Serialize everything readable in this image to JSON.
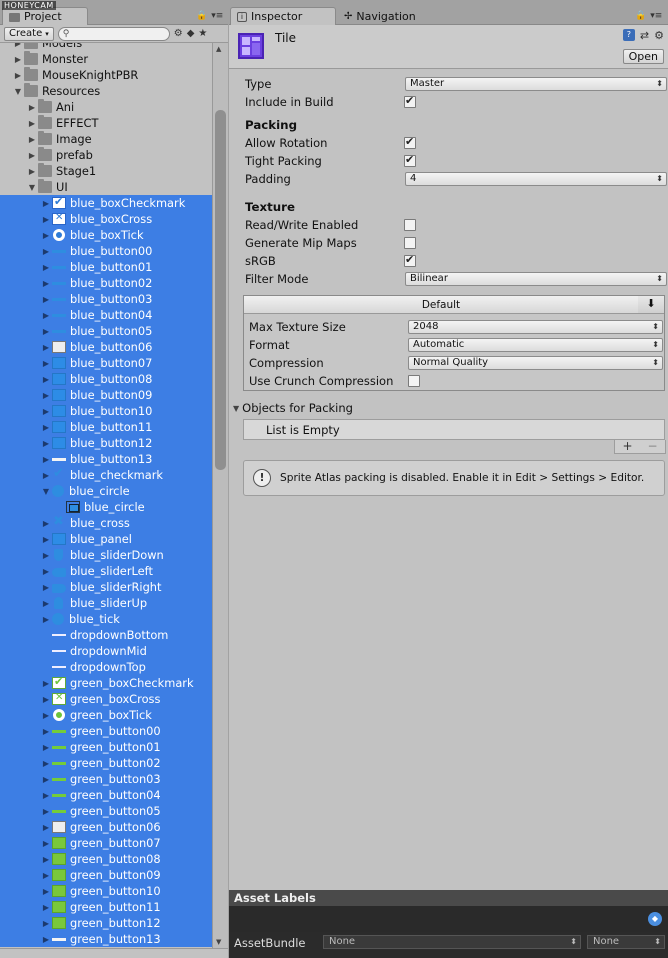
{
  "watermark": "HONEYCAM",
  "project_panel": {
    "tab_label": "Project",
    "create_label": "Create",
    "search_placeholder": "",
    "tree": [
      {
        "label": "Models",
        "type": "folder",
        "depth": 1,
        "fold": "right",
        "selected": false
      },
      {
        "label": "Monster",
        "type": "folder",
        "depth": 1,
        "fold": "right",
        "selected": false
      },
      {
        "label": "MouseKnightPBR",
        "type": "folder",
        "depth": 1,
        "fold": "right",
        "selected": false
      },
      {
        "label": "Resources",
        "type": "folder",
        "depth": 1,
        "fold": "down",
        "selected": false
      },
      {
        "label": "Ani",
        "type": "folder",
        "depth": 2,
        "fold": "right",
        "selected": false
      },
      {
        "label": "EFFECT",
        "type": "folder",
        "depth": 2,
        "fold": "right",
        "selected": false
      },
      {
        "label": "Image",
        "type": "folder",
        "depth": 2,
        "fold": "right",
        "selected": false
      },
      {
        "label": "prefab",
        "type": "folder",
        "depth": 2,
        "fold": "right",
        "selected": false
      },
      {
        "label": "Stage1",
        "type": "folder",
        "depth": 2,
        "fold": "right",
        "selected": false
      },
      {
        "label": "UI",
        "type": "folder",
        "depth": 2,
        "fold": "down",
        "selected": false
      },
      {
        "label": "blue_boxCheckmark",
        "type": "i-check",
        "depth": 3,
        "fold": "right",
        "selected": true
      },
      {
        "label": "blue_boxCross",
        "type": "i-cross",
        "depth": 3,
        "fold": "right",
        "selected": true
      },
      {
        "label": "blue_boxTick",
        "type": "i-tick",
        "depth": 3,
        "fold": "right",
        "selected": true
      },
      {
        "label": "blue_button00",
        "type": "i-bar",
        "depth": 3,
        "fold": "right",
        "selected": true
      },
      {
        "label": "blue_button01",
        "type": "i-bar",
        "depth": 3,
        "fold": "right",
        "selected": true
      },
      {
        "label": "blue_button02",
        "type": "i-bar",
        "depth": 3,
        "fold": "right",
        "selected": true
      },
      {
        "label": "blue_button03",
        "type": "i-bar",
        "depth": 3,
        "fold": "right",
        "selected": true
      },
      {
        "label": "blue_button04",
        "type": "i-bar",
        "depth": 3,
        "fold": "right",
        "selected": true
      },
      {
        "label": "blue_button05",
        "type": "i-bar",
        "depth": 3,
        "fold": "right",
        "selected": true
      },
      {
        "label": "blue_button06",
        "type": "i-white",
        "depth": 3,
        "fold": "right",
        "selected": true
      },
      {
        "label": "blue_button07",
        "type": "i-blue",
        "depth": 3,
        "fold": "right",
        "selected": true
      },
      {
        "label": "blue_button08",
        "type": "i-blue",
        "depth": 3,
        "fold": "right",
        "selected": true
      },
      {
        "label": "blue_button09",
        "type": "i-blue",
        "depth": 3,
        "fold": "right",
        "selected": true
      },
      {
        "label": "blue_button10",
        "type": "i-blue",
        "depth": 3,
        "fold": "right",
        "selected": true
      },
      {
        "label": "blue_button11",
        "type": "i-blue",
        "depth": 3,
        "fold": "right",
        "selected": true
      },
      {
        "label": "blue_button12",
        "type": "i-blue",
        "depth": 3,
        "fold": "right",
        "selected": true
      },
      {
        "label": "blue_button13",
        "type": "i-wbar",
        "depth": 3,
        "fold": "right",
        "selected": true
      },
      {
        "label": "blue_checkmark",
        "type": "i-bcheck",
        "depth": 3,
        "fold": "right",
        "selected": true
      },
      {
        "label": "blue_circle",
        "type": "i-bcircle",
        "depth": 3,
        "fold": "down",
        "selected": true
      },
      {
        "label": "blue_circle",
        "type": "i-sub",
        "depth": 4,
        "fold": "none",
        "selected": true
      },
      {
        "label": "blue_cross",
        "type": "i-bcross",
        "depth": 3,
        "fold": "right",
        "selected": true
      },
      {
        "label": "blue_panel",
        "type": "i-blue",
        "depth": 3,
        "fold": "right",
        "selected": true
      },
      {
        "label": "blue_sliderDown",
        "type": "i-sdown",
        "depth": 3,
        "fold": "right",
        "selected": true
      },
      {
        "label": "blue_sliderLeft",
        "type": "i-sleft",
        "depth": 3,
        "fold": "right",
        "selected": true
      },
      {
        "label": "blue_sliderRight",
        "type": "i-sright",
        "depth": 3,
        "fold": "right",
        "selected": true
      },
      {
        "label": "blue_sliderUp",
        "type": "i-sup",
        "depth": 3,
        "fold": "right",
        "selected": true
      },
      {
        "label": "blue_tick",
        "type": "i-btick",
        "depth": 3,
        "fold": "right",
        "selected": true
      },
      {
        "label": "dropdownBottom",
        "type": "i-wline",
        "depth": 3,
        "fold": "none",
        "selected": true
      },
      {
        "label": "dropdownMid",
        "type": "i-wline",
        "depth": 3,
        "fold": "none",
        "selected": true
      },
      {
        "label": "dropdownTop",
        "type": "i-wline",
        "depth": 3,
        "fold": "none",
        "selected": true
      },
      {
        "label": "green_boxCheckmark",
        "type": "i-gcheck",
        "depth": 3,
        "fold": "right",
        "selected": true
      },
      {
        "label": "green_boxCross",
        "type": "i-gcross",
        "depth": 3,
        "fold": "right",
        "selected": true
      },
      {
        "label": "green_boxTick",
        "type": "i-gtick",
        "depth": 3,
        "fold": "right",
        "selected": true
      },
      {
        "label": "green_button00",
        "type": "i-gbar",
        "depth": 3,
        "fold": "right",
        "selected": true
      },
      {
        "label": "green_button01",
        "type": "i-gbar",
        "depth": 3,
        "fold": "right",
        "selected": true
      },
      {
        "label": "green_button02",
        "type": "i-gbar",
        "depth": 3,
        "fold": "right",
        "selected": true
      },
      {
        "label": "green_button03",
        "type": "i-gbar",
        "depth": 3,
        "fold": "right",
        "selected": true
      },
      {
        "label": "green_button04",
        "type": "i-gbar",
        "depth": 3,
        "fold": "right",
        "selected": true
      },
      {
        "label": "green_button05",
        "type": "i-gbar",
        "depth": 3,
        "fold": "right",
        "selected": true
      },
      {
        "label": "green_button06",
        "type": "i-white",
        "depth": 3,
        "fold": "right",
        "selected": true
      },
      {
        "label": "green_button07",
        "type": "i-green",
        "depth": 3,
        "fold": "right",
        "selected": true
      },
      {
        "label": "green_button08",
        "type": "i-green",
        "depth": 3,
        "fold": "right",
        "selected": true
      },
      {
        "label": "green_button09",
        "type": "i-green",
        "depth": 3,
        "fold": "right",
        "selected": true
      },
      {
        "label": "green_button10",
        "type": "i-green",
        "depth": 3,
        "fold": "right",
        "selected": true
      },
      {
        "label": "green_button11",
        "type": "i-green",
        "depth": 3,
        "fold": "right",
        "selected": true
      },
      {
        "label": "green_button12",
        "type": "i-green",
        "depth": 3,
        "fold": "right",
        "selected": true
      },
      {
        "label": "green_button13",
        "type": "i-wbar",
        "depth": 3,
        "fold": "right",
        "selected": true
      }
    ]
  },
  "inspector": {
    "tabs": [
      {
        "label": "Inspector",
        "active": true
      },
      {
        "label": "Navigation",
        "active": false
      }
    ],
    "asset_title": "Tile",
    "open_label": "Open",
    "type": {
      "label": "Type",
      "value": "Master"
    },
    "include_in_build": {
      "label": "Include in Build",
      "checked": true
    },
    "packing": {
      "title": "Packing",
      "allow_rotation": {
        "label": "Allow Rotation",
        "checked": true
      },
      "tight_packing": {
        "label": "Tight Packing",
        "checked": true
      },
      "padding": {
        "label": "Padding",
        "value": "4"
      }
    },
    "texture": {
      "title": "Texture",
      "read_write": {
        "label": "Read/Write Enabled",
        "checked": false
      },
      "mip_maps": {
        "label": "Generate Mip Maps",
        "checked": false
      },
      "srgb": {
        "label": "sRGB",
        "checked": true
      },
      "filter_mode": {
        "label": "Filter Mode",
        "value": "Bilinear"
      }
    },
    "platform": {
      "tab_label": "Default",
      "max_texture_size": {
        "label": "Max Texture Size",
        "value": "2048"
      },
      "format": {
        "label": "Format",
        "value": "Automatic"
      },
      "compression": {
        "label": "Compression",
        "value": "Normal Quality"
      },
      "crunch": {
        "label": "Use Crunch Compression",
        "checked": false
      }
    },
    "objects_for_packing": {
      "title": "Objects for Packing",
      "empty_text": "List is Empty",
      "add_label": "+",
      "remove_label": "−"
    },
    "help_message": "Sprite Atlas packing is disabled. Enable it in Edit > Settings > Editor.",
    "asset_labels": {
      "title": "Asset Labels"
    },
    "asset_bundle": {
      "label": "AssetBundle",
      "name": "None",
      "variant": "None"
    }
  },
  "colors": {
    "selection": "#3d7ee4",
    "panel": "#c2c2c2",
    "atlas_icon": "#6b3fe0"
  }
}
